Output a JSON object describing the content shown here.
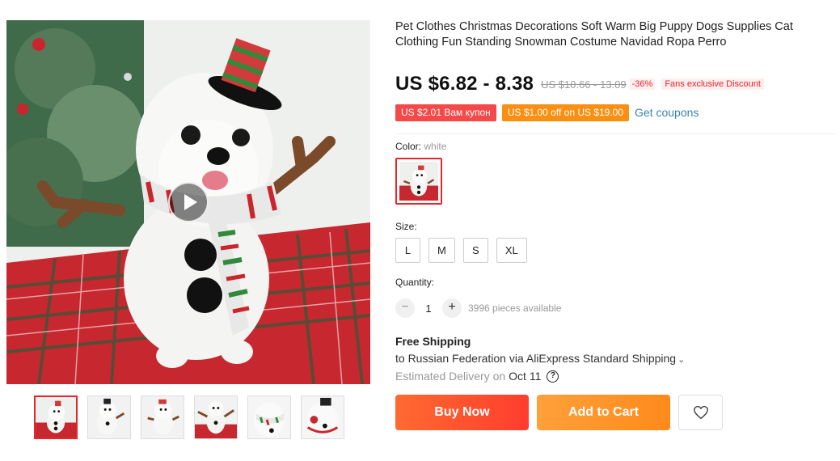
{
  "product": {
    "title": "Pet Clothes Christmas Decorations Soft Warm Big Puppy Dogs Supplies Cat Clothing Fun Standing Snowman Costume Navidad Ropa Perro",
    "price": "US $6.82 - 8.38",
    "old_price": "US $10.66 - 13.09",
    "discount": "-36%",
    "fans_badge": "Fans exclusive Discount"
  },
  "coupons": {
    "coupon1": "US $2.01 Вам купон",
    "coupon2": "US $1.00 off on US $19.00",
    "get_coupons": "Get coupons"
  },
  "color": {
    "label": "Color:",
    "selected": "white"
  },
  "size": {
    "label": "Size:",
    "options": [
      "L",
      "M",
      "S",
      "XL"
    ]
  },
  "quantity": {
    "label": "Quantity:",
    "value": "1",
    "minus": "−",
    "plus": "+",
    "available": "3996 pieces available"
  },
  "shipping": {
    "title": "Free Shipping",
    "to": "to Russian Federation via AliExpress Standard Shipping",
    "chevron": "⌄",
    "estimated_label": "Estimated Delivery on",
    "date": "Oct 11",
    "help": "?"
  },
  "actions": {
    "buy_now": "Buy Now",
    "add_to_cart": "Add to Cart"
  },
  "icons": {
    "play": "play-icon",
    "wishlist": "heart-icon",
    "help": "question-circle-icon"
  },
  "colors": {
    "accent_red": "#e5262c",
    "buy_now": "#ff4a2e",
    "add_to_cart": "#ff941f",
    "link": "#3a82a8"
  }
}
